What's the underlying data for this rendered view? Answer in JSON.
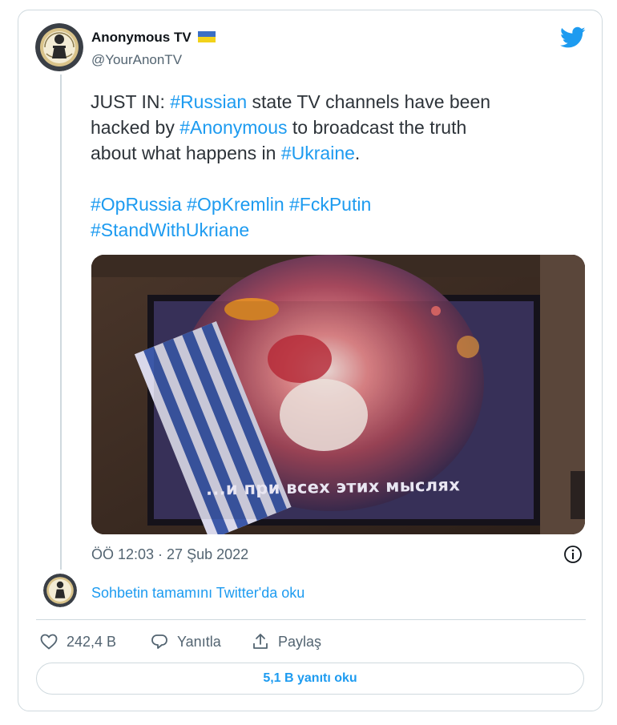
{
  "author": {
    "name": "Anonymous TV",
    "handle": "@YourAnonTV",
    "flag_icon": "ukraine-flag-icon",
    "colors": {
      "flag_top": "#3b6fc4",
      "flag_bottom": "#f2d21a"
    }
  },
  "brand": {
    "icon": "twitter-bird-icon",
    "color": "#1d9bf0"
  },
  "tweet": {
    "line1": [
      "JUST IN: ",
      "#Russian",
      " state TV channels have been"
    ],
    "line2": [
      "hacked by ",
      "#Anonymous",
      " to broadcast the truth"
    ],
    "line3": [
      "about what happens in ",
      "#Ukraine",
      "."
    ],
    "hashtags_line1": [
      "#OpRussia",
      "#OpKremlin",
      "#FckPutin"
    ],
    "hashtags_line2": [
      "#StandWithUkriane"
    ]
  },
  "media": {
    "subtitle": "...и при всех этих мыслях"
  },
  "timestamp": "ÖÖ 12:03 · 27 Şub 2022",
  "info_icon": "info-icon",
  "read_thread": "Sohbetin tamamını Twitter'da oku",
  "actions": {
    "like": {
      "icon": "heart-icon",
      "label": "242,4 B"
    },
    "reply": {
      "icon": "reply-bubble-icon",
      "label": "Yanıtla"
    },
    "share": {
      "icon": "share-icon",
      "label": "Paylaş"
    }
  },
  "replies_button": "5,1 B yanıtı oku",
  "colors": {
    "link": "#1d9bf0",
    "muted": "#536471",
    "border": "#cfd9de"
  }
}
